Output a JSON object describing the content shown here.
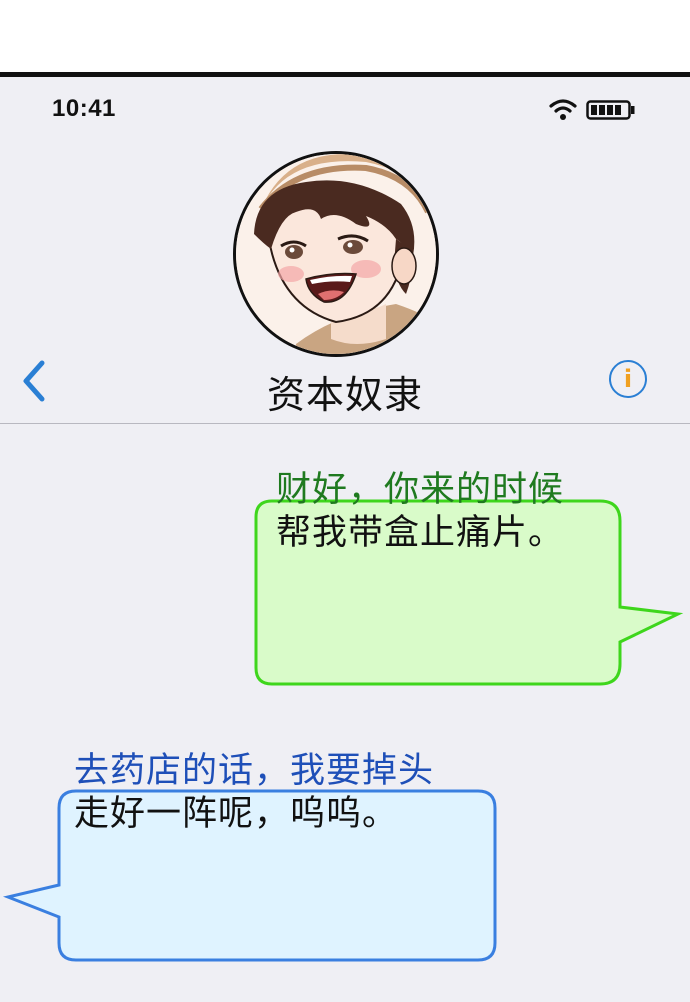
{
  "status_bar": {
    "time": "10:41",
    "wifi_icon": "wifi-icon",
    "battery_icon": "battery-icon",
    "battery_level": 0.8
  },
  "header": {
    "back_icon": "chevron-left-icon",
    "contact_name": "资本奴隶",
    "info_label": "i",
    "accent_color": "#2a7fd4"
  },
  "messages": [
    {
      "direction": "outgoing",
      "lines": [
        "财好，你来的时候",
        "帮我带盒止痛片。"
      ],
      "bubble_fill": "#d9fbc9",
      "bubble_border": "#3ed61c"
    },
    {
      "direction": "incoming",
      "lines": [
        "去药店的话，我要掉头",
        "走好一阵呢，呜呜。"
      ],
      "bubble_fill": "#dff3ff",
      "bubble_border": "#3a7fe0"
    }
  ]
}
